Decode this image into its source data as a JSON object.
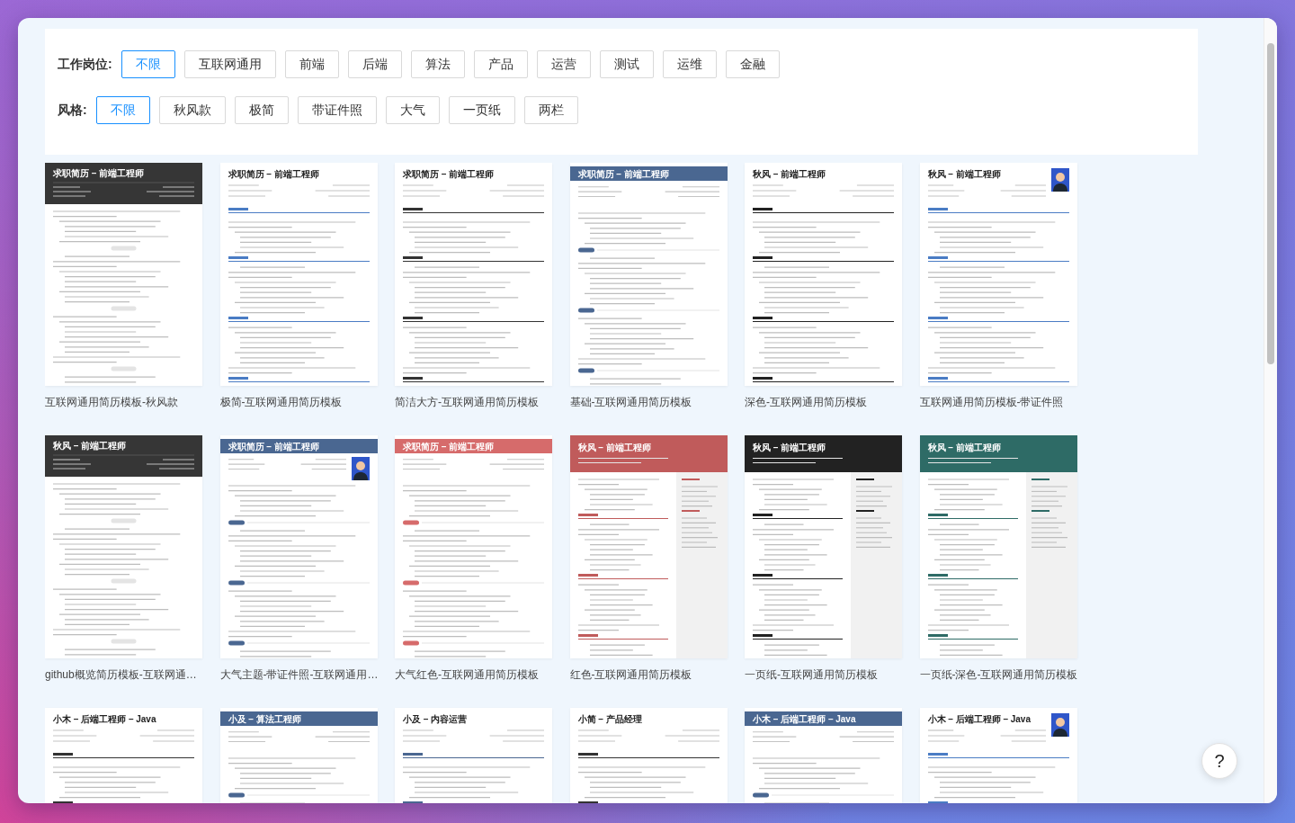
{
  "filters": [
    {
      "label": "工作岗位:",
      "options": [
        {
          "label": "不限",
          "selected": true
        },
        {
          "label": "互联网通用",
          "selected": false
        },
        {
          "label": "前端",
          "selected": false
        },
        {
          "label": "后端",
          "selected": false
        },
        {
          "label": "算法",
          "selected": false
        },
        {
          "label": "产品",
          "selected": false
        },
        {
          "label": "运营",
          "selected": false
        },
        {
          "label": "测试",
          "selected": false
        },
        {
          "label": "运维",
          "selected": false
        },
        {
          "label": "金融",
          "selected": false
        }
      ]
    },
    {
      "label": "风格:",
      "options": [
        {
          "label": "不限",
          "selected": true
        },
        {
          "label": "秋风款",
          "selected": false
        },
        {
          "label": "极简",
          "selected": false
        },
        {
          "label": "带证件照",
          "selected": false
        },
        {
          "label": "大气",
          "selected": false
        },
        {
          "label": "一页纸",
          "selected": false
        },
        {
          "label": "两栏",
          "selected": false
        }
      ]
    }
  ],
  "templates": [
    {
      "title": "互联网通用简历模板-秋风款",
      "heading": "求职简历 – 前端工程师",
      "kind": "dark",
      "color": "#363636",
      "photo": false
    },
    {
      "title": "极简-互联网通用简历模板",
      "heading": "求职简历 – 前端工程师",
      "kind": "plain",
      "color": "#4a7cc4",
      "photo": false
    },
    {
      "title": "简洁大方-互联网通用简历模板",
      "heading": "求职简历 – 前端工程师",
      "kind": "plain",
      "color": "#333333",
      "photo": false
    },
    {
      "title": "基础-互联网通用简历模板",
      "heading": "求职简历 – 前端工程师",
      "kind": "banner",
      "color": "#4a6791",
      "photo": false
    },
    {
      "title": "深色-互联网通用简历模板",
      "heading": "秋风 – 前端工程师",
      "kind": "plain",
      "color": "#222222",
      "photo": false
    },
    {
      "title": "互联网通用简历模板-带证件照",
      "heading": "秋风 – 前端工程师",
      "kind": "plain",
      "color": "#4a7cc4",
      "photo": true
    },
    {
      "title": "github概览简历模板-互联网通…",
      "heading": "秋风 – 前端工程师",
      "kind": "dark",
      "color": "#363636",
      "photo": false
    },
    {
      "title": "大气主题-带证件照-互联网通用…",
      "heading": "求职简历 – 前端工程师",
      "kind": "banner",
      "color": "#4a6791",
      "photo": true
    },
    {
      "title": "大气红色-互联网通用简历模板",
      "heading": "求职简历 – 前端工程师",
      "kind": "banner",
      "color": "#d66b6b",
      "photo": false
    },
    {
      "title": "红色-互联网通用简历模板",
      "heading": "秋风 – 前端工程师",
      "kind": "twocol",
      "color": "#c05b5b",
      "photo": false
    },
    {
      "title": "一页纸-互联网通用简历模板",
      "heading": "秋风 – 前端工程师",
      "kind": "twocol",
      "color": "#222222",
      "photo": false
    },
    {
      "title": "一页纸-深色-互联网通用简历模板",
      "heading": "秋风 – 前端工程师",
      "kind": "twocol",
      "color": "#2e6b66",
      "photo": false
    },
    {
      "heading": "小木 – 后端工程师 – Java",
      "kind": "plain",
      "color": "#333333",
      "photo": false
    },
    {
      "heading": "小及 – 算法工程师",
      "kind": "banner",
      "color": "#4a6791",
      "photo": false
    },
    {
      "heading": "小及 – 内容运营",
      "kind": "plain",
      "color": "#4a6791",
      "photo": false
    },
    {
      "heading": "小简 – 产品经理",
      "kind": "plain",
      "color": "#333333",
      "photo": false
    },
    {
      "heading": "小木 – 后端工程师 – Java",
      "kind": "banner",
      "color": "#4a6791",
      "photo": false
    },
    {
      "heading": "小木 – 后端工程师 – Java",
      "kind": "plain",
      "color": "#4a7cc4",
      "photo": true
    }
  ],
  "help_button": {
    "label": "?"
  }
}
